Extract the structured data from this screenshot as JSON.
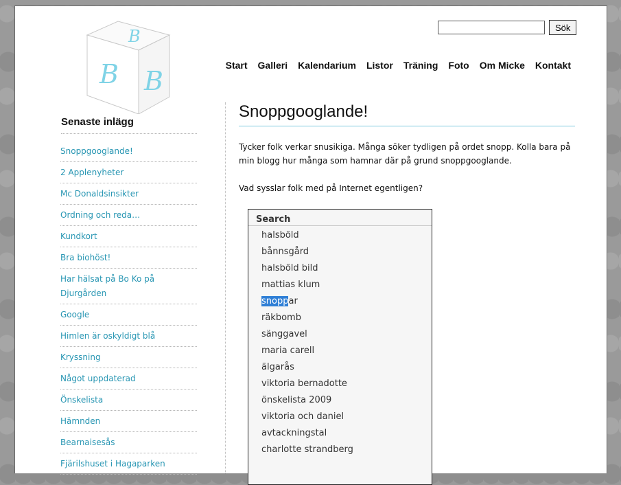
{
  "logo": {
    "letters": [
      "B",
      "B",
      "B"
    ]
  },
  "search": {
    "placeholder": "",
    "button_label": "Sök"
  },
  "nav": [
    "Start",
    "Galleri",
    "Kalendarium",
    "Listor",
    "Träning",
    "Foto",
    "Om Micke",
    "Kontakt"
  ],
  "sidebar": {
    "heading": "Senaste inlägg",
    "items": [
      "Snoppgooglande!",
      "2 Applenyheter",
      "Mc Donaldsinsikter",
      "Ordning och reda…",
      "Kundkort",
      "Bra biohöst!",
      "Har hälsat på Bo Ko på Djurgården",
      "Google",
      "Himlen är oskyldigt blå",
      "Kryssning",
      "Något uppdaterad",
      "Önskelista",
      "Hämnden",
      "Bearnaisesås",
      "Fjärilshuset i Hagaparken"
    ]
  },
  "post": {
    "title": "Snoppgooglande!",
    "paragraph1": "Tycker folk verkar snusikiga. Många söker tydligen på ordet snopp. Kolla bara på min blogg hur många som hamnar där på grund snoppgooglande.",
    "paragraph2": "Vad sysslar folk med på Internet egentligen?"
  },
  "search_box": {
    "heading": "Search",
    "terms": [
      "halsböld",
      "bånnsgård",
      "halsböld bild",
      "mattias klum",
      "snoppar",
      "räkbomb",
      "sänggavel",
      "maria carell",
      "älgarås",
      "viktoria bernadotte",
      "önskelista 2009",
      "viktoria och daniel",
      "avtackningstal",
      "charlotte strandberg"
    ],
    "highlight": {
      "term_index": 4,
      "highlighted": "snopp",
      "rest": "ar"
    }
  },
  "colors": {
    "accent": "#2896b3",
    "title_rule": "#7cc9de",
    "highlight": "#2f7fd6",
    "background": "#9a9a9a"
  }
}
